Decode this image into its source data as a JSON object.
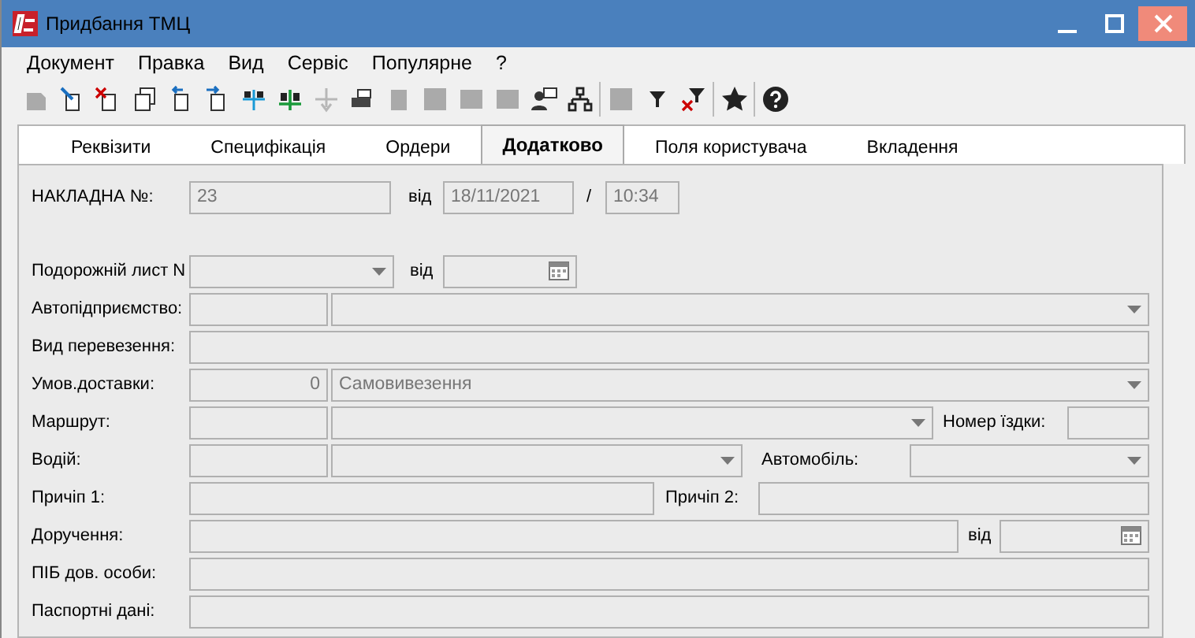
{
  "window": {
    "title": "Придбання ТМЦ"
  },
  "menu": [
    "Документ",
    "Правка",
    "Вид",
    "Сервіс",
    "Популярне",
    "?"
  ],
  "tabs": [
    {
      "label": "Реквізити",
      "selected": false
    },
    {
      "label": "Специфікація",
      "selected": false
    },
    {
      "label": "Ордери",
      "selected": false
    },
    {
      "label": "Додатково",
      "selected": true
    },
    {
      "label": "Поля користувача",
      "selected": false
    },
    {
      "label": "Вкладення",
      "selected": false
    }
  ],
  "form_rows": [
    {
      "items": [
        {
          "kind": "label",
          "text": "НАКЛАДНА №:"
        },
        {
          "kind": "text",
          "value": "23"
        },
        {
          "kind": "label",
          "text": "від"
        },
        {
          "kind": "text",
          "value": "18/11/2021"
        },
        {
          "kind": "label",
          "text": "/"
        },
        {
          "kind": "text",
          "value": "10:34"
        }
      ]
    },
    {
      "items": [
        {
          "kind": "label",
          "text": "Подорожній лист N"
        },
        {
          "kind": "combo"
        },
        {
          "kind": "label",
          "text": "від"
        },
        {
          "kind": "date"
        }
      ]
    },
    {
      "items": [
        {
          "kind": "label",
          "text": "Автопідприємство:"
        },
        {
          "kind": "text"
        },
        {
          "kind": "combo"
        }
      ]
    },
    {
      "items": [
        {
          "kind": "label",
          "text": "Вид перевезення:"
        },
        {
          "kind": "text"
        }
      ]
    },
    {
      "items": [
        {
          "kind": "label",
          "text": "Умов.доставки:"
        },
        {
          "kind": "number",
          "value": "0"
        },
        {
          "kind": "combo",
          "value": "Самовивезення"
        }
      ]
    },
    {
      "items": [
        {
          "kind": "label",
          "text": "Маршрут:"
        },
        {
          "kind": "text"
        },
        {
          "kind": "combo"
        },
        {
          "kind": "label",
          "text": "Номер їздки:"
        },
        {
          "kind": "text"
        }
      ]
    },
    {
      "items": [
        {
          "kind": "label",
          "text": "Водій:"
        },
        {
          "kind": "text"
        },
        {
          "kind": "combo"
        },
        {
          "kind": "label",
          "text": "Автомобіль:"
        },
        {
          "kind": "combo"
        }
      ]
    },
    {
      "items": [
        {
          "kind": "label",
          "text": "Причіп 1:"
        },
        {
          "kind": "text"
        },
        {
          "kind": "label",
          "text": "Причіп 2:"
        },
        {
          "kind": "text"
        }
      ]
    },
    {
      "items": [
        {
          "kind": "label",
          "text": "Доручення:"
        },
        {
          "kind": "text"
        },
        {
          "kind": "label",
          "text": "від"
        },
        {
          "kind": "date"
        }
      ]
    },
    {
      "items": [
        {
          "kind": "label",
          "text": "ПІБ дов. особи:"
        },
        {
          "kind": "text"
        }
      ]
    },
    {
      "items": [
        {
          "kind": "label",
          "text": "Паспортні дані:"
        },
        {
          "kind": "text"
        }
      ]
    }
  ]
}
